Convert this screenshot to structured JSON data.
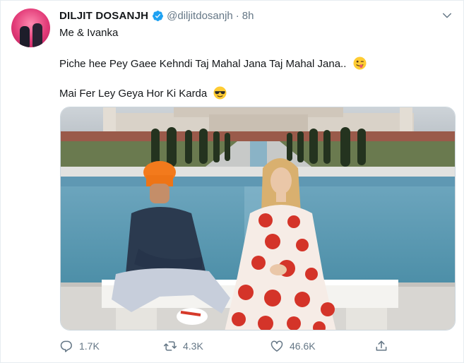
{
  "tweet": {
    "author_name": "DILJIT DOSANJH",
    "handle": "@diljitdosanjh",
    "separator": "·",
    "time": "8h",
    "lines": [
      "Me & Ivanka",
      "Piche hee Pey Gaee Kehndi Taj Mahal Jana Taj Mahal Jana..",
      "Mai Fer Ley Geya Hor Ki Karda"
    ]
  },
  "actions": {
    "replies": "1.7K",
    "retweets": "4.3K",
    "likes": "46.6K"
  },
  "icons": {
    "verified": "verified-badge-icon",
    "caret": "chevron-down-icon",
    "reply": "reply-icon",
    "retweet": "retweet-icon",
    "like": "heart-icon",
    "share": "share-icon",
    "emoji_1": "winking-tongue-emoji",
    "emoji_2": "sunglasses-emoji"
  },
  "colors": {
    "verified_blue": "#1da1f2",
    "secondary_text": "#657786",
    "primary_text": "#14171a"
  }
}
